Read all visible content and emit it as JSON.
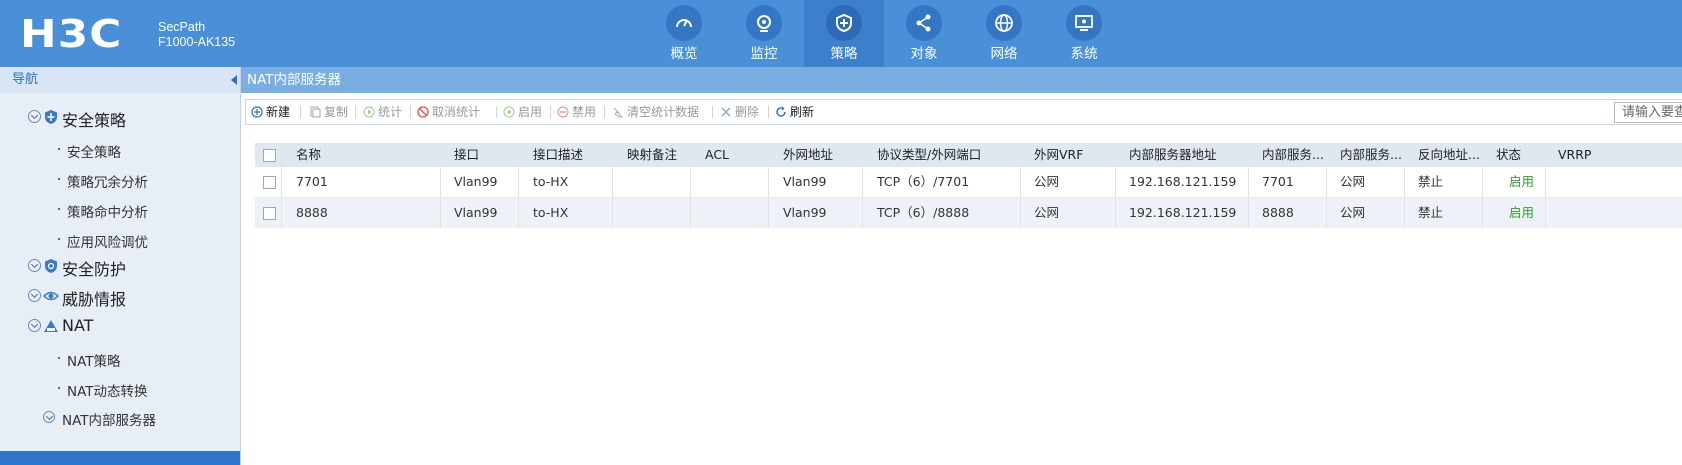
{
  "brand": {
    "logo": "H3C",
    "product_line": "SecPath",
    "model": "F1000-AK135"
  },
  "topnav": [
    {
      "label": "概览",
      "icon": "dashboard-icon"
    },
    {
      "label": "监控",
      "icon": "camera-icon"
    },
    {
      "label": "策略",
      "icon": "shield-icon",
      "active": true
    },
    {
      "label": "对象",
      "icon": "share-nodes-icon"
    },
    {
      "label": "网络",
      "icon": "globe-icon"
    },
    {
      "label": "系统",
      "icon": "monitor-icon"
    }
  ],
  "sidebar": {
    "header": "导航",
    "groups": [
      {
        "label": "安全策略",
        "icon": "shield-icon"
      },
      {
        "label": "安全防护",
        "icon": "shield-icon"
      },
      {
        "label": "威胁情报",
        "icon": "eye-icon"
      },
      {
        "label": "NAT",
        "icon": "nat-icon"
      }
    ],
    "items": [
      {
        "label": "安全策略"
      },
      {
        "label": "策略冗余分析"
      },
      {
        "label": "策略命中分析"
      },
      {
        "label": "应用风险调优"
      },
      {
        "label": "NAT策略"
      },
      {
        "label": "NAT动态转换"
      },
      {
        "label": "NAT内部服务器"
      }
    ]
  },
  "breadcrumb": "NAT内部服务器",
  "toolbar": {
    "new": "新建",
    "copy": "复制",
    "stats": "统计",
    "cancel_stats": "取消统计",
    "enable": "启用",
    "disable": "禁用",
    "clear_stats": "清空统计数据",
    "delete": "删除",
    "refresh": "刷新",
    "search_placeholder": "请输入要查"
  },
  "table": {
    "columns": [
      "名称",
      "接口",
      "接口描述",
      "映射备注",
      "ACL",
      "外网地址",
      "协议类型/外网端口",
      "外网VRF",
      "内部服务器地址",
      "内部服务...",
      "内部服务...",
      "反向地址...",
      "状态",
      "VRRP"
    ],
    "rows": [
      [
        "7701",
        "Vlan99",
        "to-HX",
        "",
        "",
        "Vlan99",
        "TCP（6）/7701",
        "公网",
        "192.168.121.159",
        "7701",
        "公网",
        "禁止",
        "启用",
        ""
      ],
      [
        "8888",
        "Vlan99",
        "to-HX",
        "",
        "",
        "Vlan99",
        "TCP（6）/8888",
        "公网",
        "192.168.121.159",
        "8888",
        "公网",
        "禁止",
        "启用",
        ""
      ]
    ]
  },
  "colors": {
    "header_bg": "#4a90d9",
    "active_nav": "#3c80cc",
    "breadcrumb_bg": "#7aaee3",
    "status_enabled": "#2aa12a"
  }
}
